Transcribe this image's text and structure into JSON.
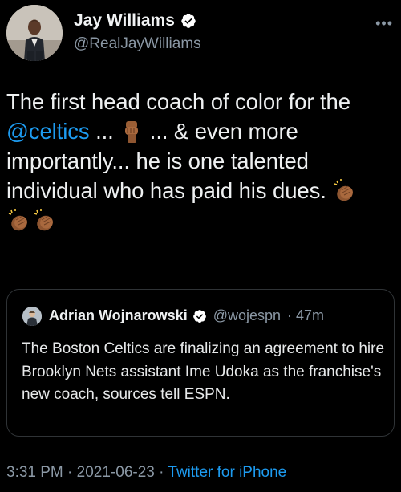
{
  "author": {
    "name": "Jay Williams",
    "handle": "@RealJayWilliams"
  },
  "tweet": {
    "line1": "The first head coach of color for the",
    "mention": "@celtics",
    "line2_a": " ... ",
    "line2_b": " ... & even more",
    "line3": "importantly...  he is one talented",
    "line4": "individual who has paid his dues. ",
    "emojis": [
      "raised-fist-medium-dark",
      "clapping-hands-medium-dark",
      "clapping-hands-medium-dark",
      "clapping-hands-medium-dark"
    ]
  },
  "quoted": {
    "name": "Adrian Wojnarowski",
    "handle": "@wojespn",
    "time": "· 47m",
    "text": "The Boston Celtics are finalizing an agreement to hire Brooklyn Nets assistant Ime Udoka as the franchise's new coach, sources tell ESPN."
  },
  "meta": {
    "time": "3:31 PM",
    "sep1": " · ",
    "date": "2021-06-23",
    "sep2": " · ",
    "source": "Twitter for iPhone"
  },
  "colors": {
    "background": "#000000",
    "link": "#1d9bf0",
    "secondary": "#8b98a5",
    "verified": "#1d9bf0"
  }
}
